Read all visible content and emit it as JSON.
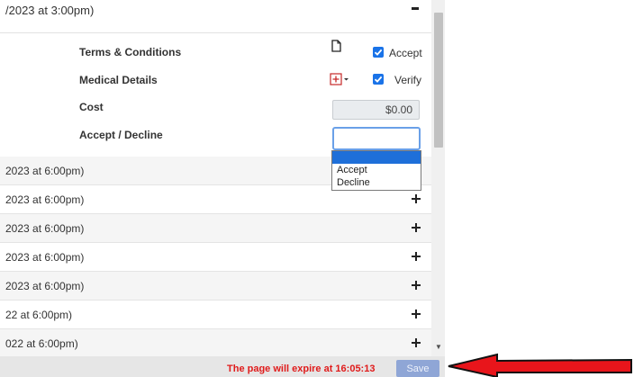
{
  "header": {
    "text": "/2023 at 3:00pm)"
  },
  "details": {
    "terms": {
      "label": "Terms & Conditions",
      "icon": "document-icon",
      "checkbox_label": "Accept",
      "checked": true
    },
    "medical": {
      "label": "Medical Details",
      "icon": "medical-add-icon",
      "checkbox_label": "Verify",
      "checked": true
    },
    "cost": {
      "label": "Cost",
      "value": "$0.00"
    },
    "accept_decline": {
      "label": "Accept / Decline",
      "selected": "",
      "options": [
        "",
        "Accept",
        "Decline"
      ]
    }
  },
  "list": [
    {
      "text": "2023 at 6:00pm)",
      "icon": "minus-icon"
    },
    {
      "text": "2023 at 6:00pm)",
      "icon": "plus-icon"
    },
    {
      "text": "2023 at 6:00pm)",
      "icon": "plus-icon"
    },
    {
      "text": "2023 at 6:00pm)",
      "icon": "plus-icon"
    },
    {
      "text": "2023 at 6:00pm)",
      "icon": "plus-icon"
    },
    {
      "text": "22 at 6:00pm)",
      "icon": "plus-icon"
    },
    {
      "text": "022 at 6:00pm)",
      "icon": "plus-icon"
    }
  ],
  "footer": {
    "expire_text": "The page will expire at 16:05:13",
    "save_label": "Save"
  },
  "colors": {
    "accent": "#1a73e8",
    "warning": "#e01b1b",
    "arrow": "#e8151b",
    "save_button": "#8fa6d6"
  }
}
